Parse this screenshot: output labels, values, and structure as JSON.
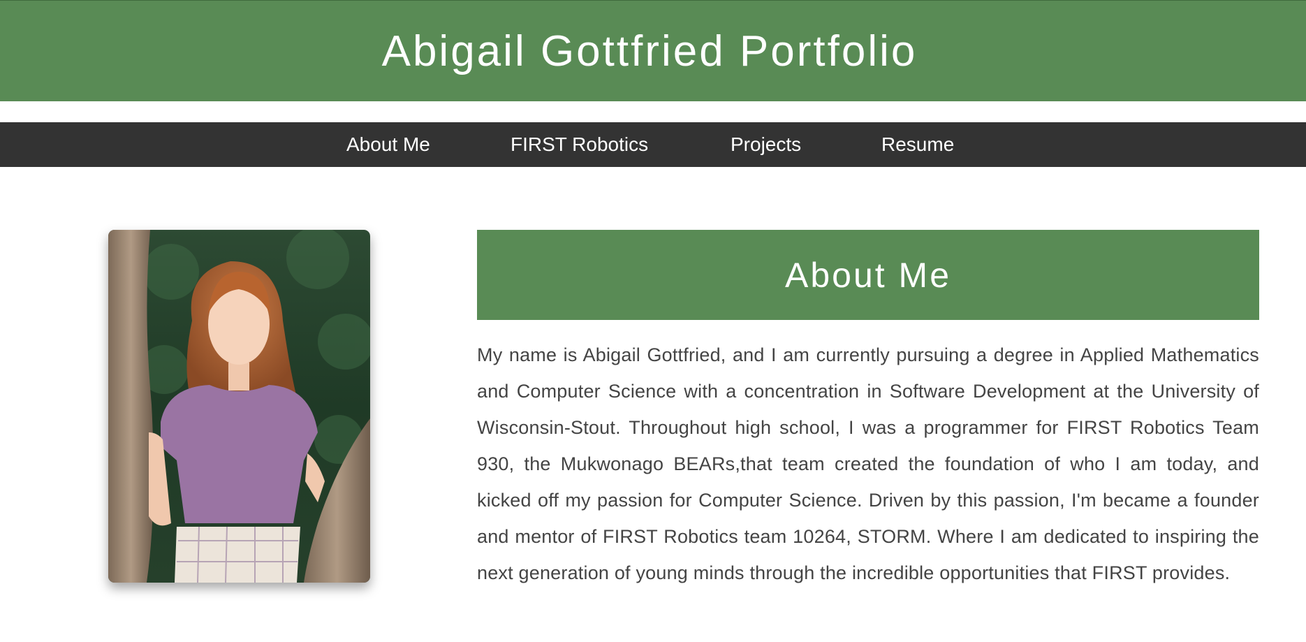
{
  "header": {
    "title": "Abigail Gottfried Portfolio"
  },
  "nav": {
    "items": [
      {
        "label": "About Me"
      },
      {
        "label": "FIRST Robotics"
      },
      {
        "label": "Projects"
      },
      {
        "label": "Resume"
      }
    ]
  },
  "about": {
    "title": "About Me",
    "body": "My name is Abigail Gottfried, and I am currently pursuing a degree in Applied Mathematics and Computer Science with a concentration in Software Development at the University of Wisconsin-Stout. Throughout high school, I was a programmer for FIRST Robotics Team 930, the Mukwonago BEARs,that team created the foundation of who I am today, and kicked off my passion for Computer Science. Driven by this passion, I'm became a founder and mentor of FIRST Robotics team 10264, STORM. Where I am dedicated to inspiring the next generation of young minds through the incredible opportunities that FIRST provides."
  },
  "colors": {
    "accent_green": "#598b55",
    "nav_background": "#333333",
    "text": "#444444"
  }
}
